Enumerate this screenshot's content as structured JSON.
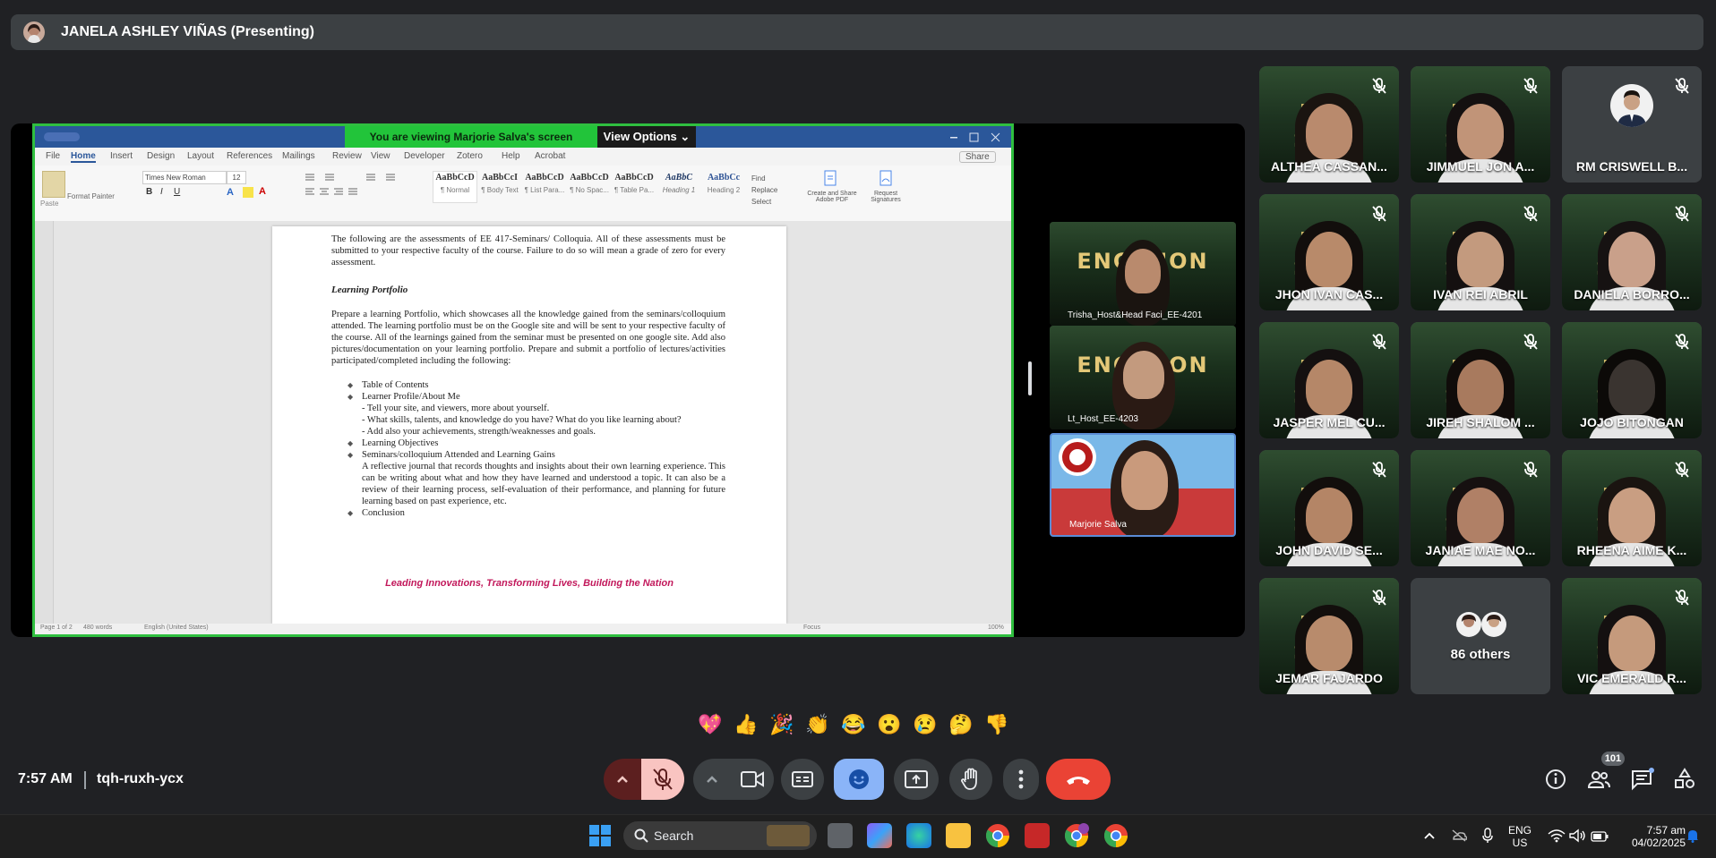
{
  "presenter": {
    "name": "JANELA ASHLEY VIÑAS (Presenting)"
  },
  "shared_screen": {
    "viewing_banner": "You are viewing  Marjorie Salva's screen",
    "view_options": "View Options",
    "ribbon_tabs": [
      "File",
      "Home",
      "Insert",
      "Design",
      "Layout",
      "References",
      "Mailings",
      "Review",
      "View",
      "Developer",
      "Zotero",
      "Help",
      "Acrobat"
    ],
    "share_label": "Share",
    "font_name": "Times New Roman",
    "font_size": "12",
    "styles": [
      {
        "sample": "AaBbCcD",
        "name": "¶ Normal"
      },
      {
        "sample": "AaBbCcI",
        "name": "¶ Body Text"
      },
      {
        "sample": "AaBbCcD",
        "name": "¶ List Para..."
      },
      {
        "sample": "AaBbCcD",
        "name": "¶ No Spac..."
      },
      {
        "sample": "AaBbCcD",
        "name": "¶ Table Pa..."
      },
      {
        "sample": "AaBbC",
        "name": "Heading 1"
      },
      {
        "sample": "AaBbCc",
        "name": "Heading 2"
      }
    ],
    "editing": [
      "Find",
      "Replace",
      "Select"
    ],
    "acrobat": [
      "Create and Share Adobe PDF",
      "Request Signatures"
    ],
    "clipboard": [
      "Paste",
      "Format Painter"
    ],
    "document": {
      "intro": "The following are the assessments of EE 417-Seminars/ Colloquia. All of these assessments must be submitted to your respective faculty of the course. Failure to do so will mean a grade of zero for every assessment.",
      "heading": "Learning Portfolio",
      "body": "Prepare a learning Portfolio, which showcases all the knowledge gained from the seminars/colloquium attended. The learning portfolio must be on the Google site and will be sent to your respective faculty of the course. All of the learnings gained from the seminar must be presented on one google site. Add also pictures/documentation on your learning portfolio. Prepare and submit a portfolio of lectures/activities participated/completed including the following:",
      "items": [
        {
          "type": "bullet",
          "text": "Table of Contents"
        },
        {
          "type": "bullet",
          "text": "Learner Profile/About Me"
        },
        {
          "type": "sub",
          "text": "- Tell your site, and viewers, more about yourself."
        },
        {
          "type": "sub",
          "text": "- What skills, talents, and knowledge do you have? What do you like learning about?"
        },
        {
          "type": "sub",
          "text": "- Add also your achievements, strength/weaknesses and goals."
        },
        {
          "type": "bullet",
          "text": "Learning Objectives"
        },
        {
          "type": "bullet",
          "text": "Seminars/colloquium Attended and Learning Gains"
        },
        {
          "type": "para",
          "text": "A reflective journal that records thoughts and insights about their own learning experience. This can be writing about what and how they have learned and understood a topic. It can also be a review of their learning process, self-evaluation of their performance, and planning for future learning based on past experience, etc."
        },
        {
          "type": "bullet",
          "text": "Conclusion"
        }
      ],
      "footer": "Leading Innovations, Transforming Lives, Building the Nation"
    },
    "status": {
      "page": "Page 1 of 2",
      "words": "480 words",
      "language": "English (United States)",
      "focus": "Focus",
      "zoom": "100%"
    }
  },
  "side_videos": [
    {
      "label": "Trisha_Host&Head Faci_EE-4201"
    },
    {
      "label": "Lt_Host_EE-4203"
    },
    {
      "label": "Marjorie Salva"
    }
  ],
  "banner_text": "ENG SION",
  "participants": [
    {
      "name": "ALTHEA CASSAN...",
      "skin": "#b98a6d",
      "hair": "#1a1410"
    },
    {
      "name": "JIMMUEL JON A...",
      "skin": "#c19478",
      "hair": "#141010"
    },
    {
      "name": "RM CRISWELL B...",
      "skin": "#d0a487",
      "hair": "#1a1410"
    },
    {
      "name": "JHON IVAN CAS...",
      "skin": "#b88a6a",
      "hair": "#120e0c"
    },
    {
      "name": "IVAN REI ABRIL",
      "skin": "#c39a7e",
      "hair": "#141010"
    },
    {
      "name": "DANIELA BORRO...",
      "skin": "#c9a08a",
      "hair": "#161212"
    },
    {
      "name": "JASPER MEL CU...",
      "skin": "#b58768",
      "hair": "#141010"
    },
    {
      "name": "JIREH SHALOM ...",
      "skin": "#a87a5e",
      "hair": "#100c0a"
    },
    {
      "name": "JOJO BITONGAN",
      "skin": "#3a3430",
      "hair": "#0c0a08"
    },
    {
      "name": "JOHN DAVID SE...",
      "skin": "#b48566",
      "hair": "#120e0c"
    },
    {
      "name": "JANIAE MAE NO...",
      "skin": "#b08066",
      "hair": "#161010"
    },
    {
      "name": "RHEENA AIME K...",
      "skin": "#c99e82",
      "hair": "#1a1410"
    },
    {
      "name": "JEMAR FAJARDO",
      "skin": "#b88b6c",
      "hair": "#120e0c"
    },
    {
      "name": "86 others",
      "skin": "",
      "hair": ""
    },
    {
      "name": "VIC EMERALD R...",
      "skin": "#c59a7c",
      "hair": "#141010"
    }
  ],
  "reactions": [
    "💖",
    "👍",
    "🎉",
    "👏",
    "😂",
    "😮",
    "😢",
    "🤔",
    "👎"
  ],
  "meeting": {
    "time": "7:57 AM",
    "code": "tqh-ruxh-ycx"
  },
  "people_count": "101",
  "taskbar": {
    "search": "Search",
    "lang_top": "ENG",
    "lang_bottom": "US",
    "time": "7:57 am",
    "date": "04/02/2025"
  },
  "colors": {
    "presenting_border": "#2fbf3f",
    "end_call": "#ea4335",
    "active_control": "#8ab4f8",
    "mic_off": "#f9c4c1"
  }
}
